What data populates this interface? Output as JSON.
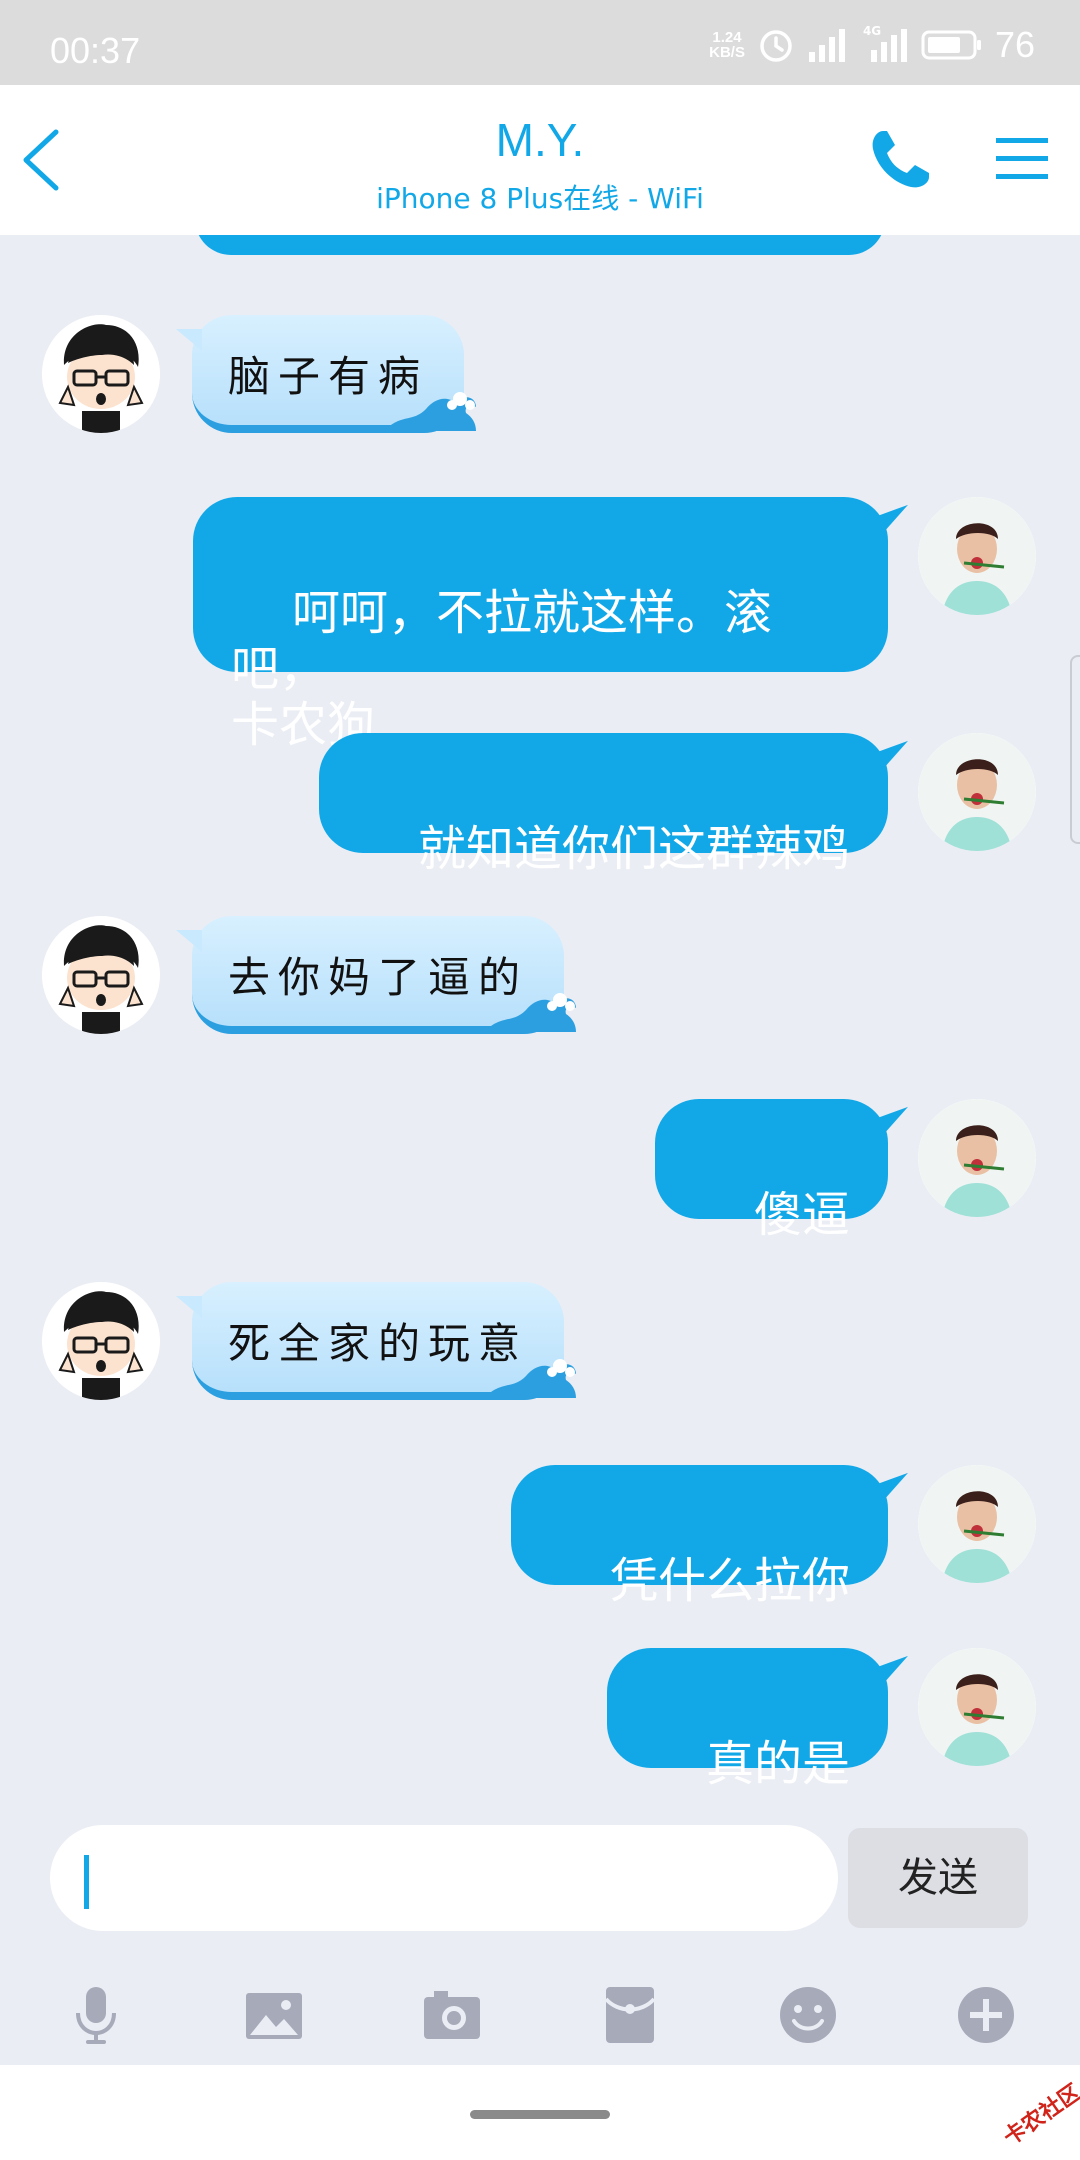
{
  "status_bar": {
    "time": "00:37",
    "net_speed_value": "1.24",
    "net_speed_unit": "KB/S",
    "network_type": "4G",
    "battery": "76"
  },
  "header": {
    "title": "M.Y.",
    "subtitle": "iPhone 8 Plus在线 - WiFi"
  },
  "messages": [
    {
      "side": "other",
      "text": "脑子有病"
    },
    {
      "side": "me",
      "text": "呵呵，不拉就这样。滚吧，\n卡农狗"
    },
    {
      "side": "me",
      "text": "就知道你们这群辣鸡"
    },
    {
      "side": "other",
      "text": "去你妈了逼的"
    },
    {
      "side": "me",
      "text": "傻逼"
    },
    {
      "side": "other",
      "text": "死全家的玩意"
    },
    {
      "side": "me",
      "text": "凭什么拉你"
    },
    {
      "side": "me",
      "text": "真的是"
    }
  ],
  "composer": {
    "input_value": "",
    "send_label": "发送"
  },
  "toolbar_icons": [
    "microphone-icon",
    "image-icon",
    "camera-icon",
    "red-packet-icon",
    "emoji-icon",
    "plus-icon"
  ],
  "watermark": "卡农社区",
  "colors": {
    "accent": "#12a8e8",
    "background": "#eaedf4",
    "icon_gray": "#a7aab8"
  }
}
